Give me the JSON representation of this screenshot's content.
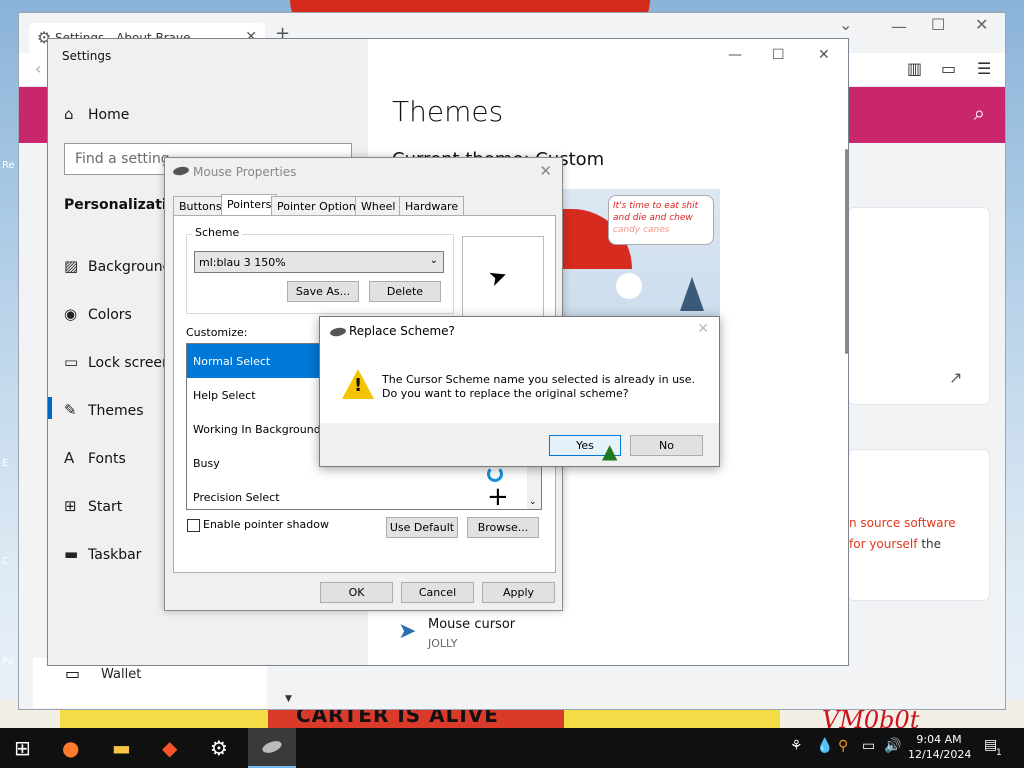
{
  "desktop": {
    "banner_text": "CARTER IS ALIVE",
    "watermark": "VM0b0t",
    "side_labels": [
      "Re",
      "E",
      "C",
      "Pa"
    ]
  },
  "brave": {
    "tab_title": "Settings - About Brave",
    "new_tab": "+",
    "content_text_1": "n source software",
    "content_text_2a": "for yourself",
    "content_text_2b": " the",
    "wallet_label": "Wallet"
  },
  "settings": {
    "window_title": "Settings",
    "home": "Home",
    "search_placeholder": "Find a setting",
    "section": "Personalization",
    "nav": [
      {
        "label": "Background",
        "icon": "image-icon"
      },
      {
        "label": "Colors",
        "icon": "palette-icon"
      },
      {
        "label": "Lock screen",
        "icon": "lock-screen-icon"
      },
      {
        "label": "Themes",
        "icon": "themes-icon"
      },
      {
        "label": "Fonts",
        "icon": "fonts-icon"
      },
      {
        "label": "Start",
        "icon": "start-icon"
      },
      {
        "label": "Taskbar",
        "icon": "taskbar-icon"
      }
    ],
    "page_title": "Themes",
    "current_theme": "Current theme: Custom",
    "theme_bubble_1": "It's time to eat shit",
    "theme_bubble_2": "and die and chew",
    "theme_bubble_3": "candy canes",
    "mouse_cursor_label": "Mouse cursor",
    "mouse_cursor_value": "JOLLY"
  },
  "mouse_properties": {
    "title": "Mouse Properties",
    "tabs": [
      "Buttons",
      "Pointers",
      "Pointer Options",
      "Wheel",
      "Hardware"
    ],
    "active_tab": "Pointers",
    "scheme_label": "Scheme",
    "scheme_value": "ml:blau 3 150%",
    "save_as": "Save As...",
    "delete": "Delete",
    "customize_label": "Customize:",
    "pointers": [
      "Normal Select",
      "Help Select",
      "Working In Background",
      "Busy",
      "Precision Select"
    ],
    "selected_pointer": "Normal Select",
    "shadow_label": "Enable pointer shadow",
    "use_default": "Use Default",
    "browse": "Browse...",
    "ok": "OK",
    "cancel": "Cancel",
    "apply": "Apply"
  },
  "replace_dialog": {
    "title": "Replace Scheme?",
    "message": "The Cursor Scheme name you selected is already in use.  Do you want to replace the original scheme?",
    "yes": "Yes",
    "no": "No"
  },
  "taskbar": {
    "time": "9:04 AM",
    "date": "12/14/2024",
    "notification_count": "1"
  }
}
